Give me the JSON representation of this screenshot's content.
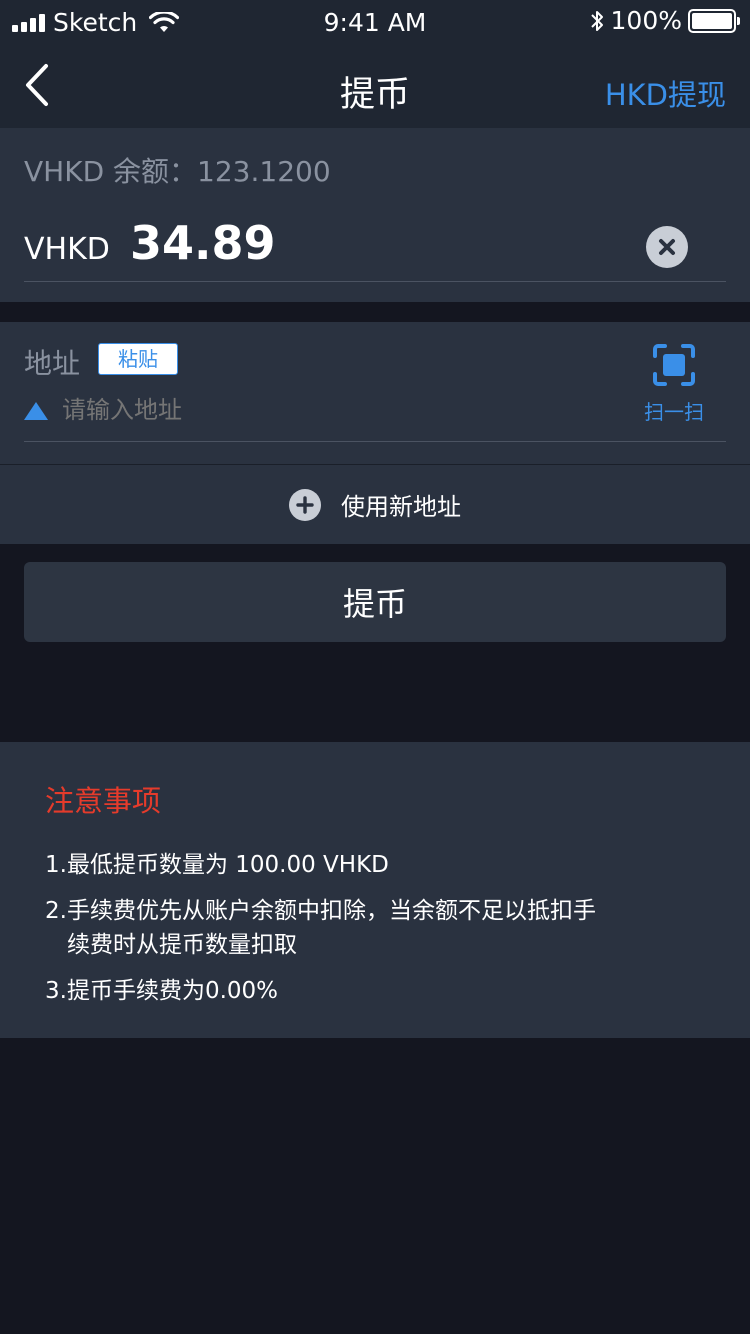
{
  "status_bar": {
    "carrier": "Sketch",
    "time": "9:41 AM",
    "battery": "100%"
  },
  "nav": {
    "title": "提币",
    "right_link": "HKD提现"
  },
  "amount": {
    "balance_text": "VHKD 余额：123.1200",
    "currency": "VHKD",
    "value": "34.89"
  },
  "address": {
    "label": "地址",
    "paste_label": "粘贴",
    "placeholder": "请输入地址",
    "scan_label": "扫一扫"
  },
  "new_address": {
    "label": "使用新地址"
  },
  "submit": {
    "label": "提币"
  },
  "notes": {
    "title": "注意事项",
    "items": [
      {
        "line1": "1.最低提币数量为 100.00 VHKD",
        "line2": ""
      },
      {
        "line1": "2.手续费优先从账户余额中扣除，当余额不足以抵扣手",
        "line2": "续费时从提币数量扣取"
      },
      {
        "line1": "3.提币手续费为0.00%",
        "line2": ""
      }
    ]
  },
  "colors": {
    "accent": "#3a8fe8",
    "warning": "#e53b2b",
    "card": "#2a3240",
    "background": "#141620"
  }
}
